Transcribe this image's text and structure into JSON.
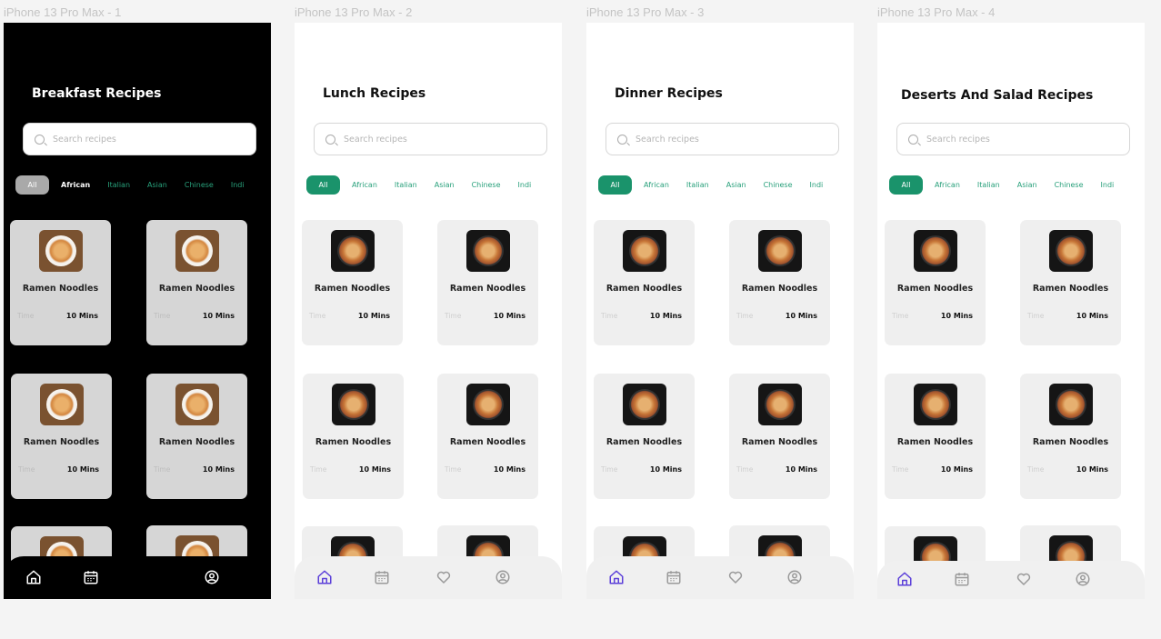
{
  "frames": [
    {
      "label": "iPhone 13 Pro Max - 1",
      "title": "Breakfast Recipes",
      "theme": "dark"
    },
    {
      "label": "iPhone 13 Pro Max - 2",
      "title": "Lunch Recipes",
      "theme": "light"
    },
    {
      "label": "iPhone 13 Pro Max - 3",
      "title": "Dinner Recipes",
      "theme": "light"
    },
    {
      "label": "iPhone 13 Pro Max - 4",
      "title": "Deserts And Salad Recipes",
      "theme": "light"
    }
  ],
  "search": {
    "placeholder": "Search recipes"
  },
  "chips": [
    "All",
    "African",
    "Italian",
    "Asian",
    "Chinese",
    "Indi"
  ],
  "card": {
    "name": "Ramen Noodles",
    "time_label": "Time",
    "time_value": "10 Mins"
  },
  "nav_icons": [
    "home-icon",
    "calendar-icon",
    "heart-icon",
    "profile-icon"
  ],
  "colors": {
    "accent": "#1a936b",
    "chip_text": "#28a07b",
    "nav_active": "#5b3fd9",
    "nav_inactive": "#9a9a9a"
  }
}
